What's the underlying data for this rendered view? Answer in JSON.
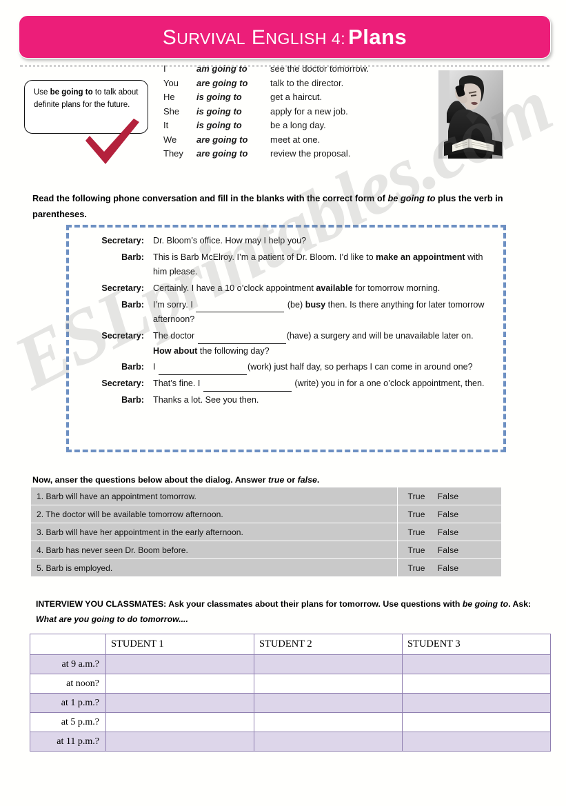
{
  "header": {
    "title_lead": "S",
    "title_part1": "URVIVAL",
    "title_lead2": "E",
    "title_part2": "NGLISH 4:",
    "title_bold": "Plans",
    "title_full": "SURVIVAL ENGLISH 4: Plans",
    "banner_color": "#ec1e79"
  },
  "watermark": {
    "text": "ESLprintables.com"
  },
  "tip_bubble": {
    "text_before": "Use ",
    "text_bold": "be going to",
    "text_after": " to talk about definite plans for the future.",
    "check_color": "#b4213c"
  },
  "photo": {
    "alt": "woman-on-phone-photo"
  },
  "grammar": {
    "rows": [
      {
        "subject": "I",
        "aux": "am going to",
        "rest": "see the doctor tomorrow."
      },
      {
        "subject": "You",
        "aux": "are going to",
        "rest": "talk to the director."
      },
      {
        "subject": "He",
        "aux": "is going to",
        "rest": "get a haircut."
      },
      {
        "subject": "She",
        "aux": "is going to",
        "rest": "apply for a new job."
      },
      {
        "subject": "It",
        "aux": "is going to",
        "rest": "be a long day."
      },
      {
        "subject": "We",
        "aux": "are going to",
        "rest": "meet at one."
      },
      {
        "subject": "They",
        "aux": "are going to",
        "rest": "review the proposal."
      }
    ]
  },
  "instructions": {
    "read_task_a": "Read the following phone conversation and fill in the blanks with the correct form of ",
    "read_task_em": "be going to",
    "read_task_b": " plus the verb in parentheses.",
    "tf_task_a": "Now, anser the questions below about the dialog. Answer ",
    "tf_task_em1": "true",
    "tf_task_mid": "  or ",
    "tf_task_em2": "false",
    "tf_task_b": ".",
    "interview_a": "INTERVIEW YOU CLASSMATES: Ask your classmates about their plans for tomorrow. Use questions with ",
    "interview_em1": "be going to",
    "interview_mid": ". Ask: ",
    "interview_em2": "What are you going to do tomorrow....",
    "border_color": "#6d90c2"
  },
  "dialog": {
    "lines": [
      {
        "speaker": "Secretary:",
        "segments": [
          {
            "type": "text",
            "value": "Dr. Bloom’s office. How may I help you?"
          }
        ]
      },
      {
        "speaker": "Barb:",
        "segments": [
          {
            "type": "text",
            "value": "This is Barb McElroy. I’m a patient of Dr. Bloom. I’d like to "
          },
          {
            "type": "bold",
            "value": "make an appointment"
          },
          {
            "type": "text",
            "value": " with him please."
          }
        ]
      },
      {
        "speaker": "Secretary:",
        "segments": [
          {
            "type": "text",
            "value": "Certainly. I have a 10 o’clock appointment "
          },
          {
            "type": "bold",
            "value": "available"
          },
          {
            "type": "text",
            "value": " for tomorrow morning."
          }
        ]
      },
      {
        "speaker": "Barb:",
        "segments": [
          {
            "type": "text",
            "value": "I’m sorry. I "
          },
          {
            "type": "blank",
            "value": ""
          },
          {
            "type": "text",
            "value": " (be) "
          },
          {
            "type": "bold",
            "value": "busy"
          },
          {
            "type": "text",
            "value": " then. Is there anything for later tomorrow afternoon?"
          }
        ]
      },
      {
        "speaker": "Secretary:",
        "segments": [
          {
            "type": "text",
            "value": "The doctor "
          },
          {
            "type": "blank",
            "value": ""
          },
          {
            "type": "text",
            "value": "(have) a surgery and will be unavailable later on. "
          },
          {
            "type": "bold",
            "value": "How about"
          },
          {
            "type": "text",
            "value": " the following day?"
          }
        ]
      },
      {
        "speaker": "Barb:",
        "segments": [
          {
            "type": "text",
            "value": "I "
          },
          {
            "type": "blank",
            "value": ""
          },
          {
            "type": "text",
            "value": "(work) just half day, so perhaps I can come in around one?"
          }
        ]
      },
      {
        "speaker": "Secretary:",
        "segments": [
          {
            "type": "text",
            "value": "That’s fine. I "
          },
          {
            "type": "blank",
            "value": ""
          },
          {
            "type": "text",
            "value": " (write) you in for a one o’clock appointment, then."
          }
        ]
      },
      {
        "speaker": "Barb:",
        "segments": [
          {
            "type": "text",
            "value": "Thanks a lot. See you then."
          }
        ]
      }
    ]
  },
  "true_false": {
    "true_label": "True",
    "false_label": "False",
    "rows": [
      "1. Barb will have an appointment tomorrow.",
      "2. The doctor will be available tomorrow afternoon.",
      "3. Barb will have her appointment in the early afternoon.",
      "4. Barb has never seen Dr. Boom before.",
      "5. Barb is employed."
    ]
  },
  "students_table": {
    "corner": "",
    "columns": [
      "STUDENT 1",
      "STUDENT 2",
      "STUDENT 3"
    ],
    "rows": [
      {
        "label": "at 9 a.m.?",
        "shaded": true,
        "cells": [
          "",
          "",
          ""
        ]
      },
      {
        "label": "at noon?",
        "shaded": false,
        "cells": [
          "",
          "",
          ""
        ]
      },
      {
        "label": "at 1 p.m.?",
        "shaded": true,
        "cells": [
          "",
          "",
          ""
        ]
      },
      {
        "label": "at 5 p.m.?",
        "shaded": false,
        "cells": [
          "",
          "",
          ""
        ]
      },
      {
        "label": "at 11 p.m.?",
        "shaded": true,
        "cells": [
          "",
          "",
          ""
        ]
      }
    ]
  }
}
